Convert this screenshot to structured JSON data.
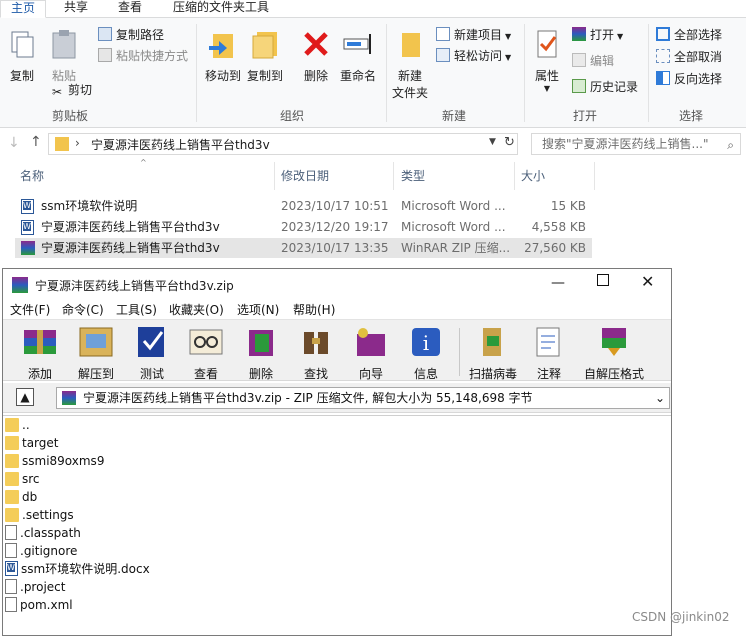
{
  "explorer": {
    "tabs": [
      "主页",
      "共享",
      "查看",
      "压缩的文件夹工具"
    ],
    "ribbon": {
      "clipboard": {
        "copy": "复制",
        "paste": "粘贴",
        "copy_path": "复制路径",
        "paste_shortcut": "粘贴快捷方式",
        "cut": "剪切",
        "group": "剪贴板"
      },
      "organize": {
        "move_to": "移动到",
        "copy_to": "复制到",
        "delete": "删除",
        "rename": "重命名",
        "group": "组织"
      },
      "new": {
        "new_folder_1": "新建",
        "new_folder_2": "文件夹",
        "new_item": "新建项目",
        "easy_access": "轻松访问",
        "group": "新建"
      },
      "open": {
        "properties": "属性",
        "open": "打开",
        "edit": "编辑",
        "history": "历史记录",
        "group": "打开"
      },
      "select": {
        "select_all": "全部选择",
        "select_none": "全部取消",
        "invert": "反向选择",
        "group": "选择"
      }
    },
    "address": {
      "path": "宁夏源沣医药线上销售平台thd3v",
      "search_placeholder": "搜索\"宁夏源沣医药线上销售...\""
    },
    "columns": {
      "name": "名称",
      "date": "修改日期",
      "type": "类型",
      "size": "大小"
    },
    "files": [
      {
        "name": "ssm环境软件说明",
        "date": "2023/10/17 10:51",
        "type": "Microsoft Word ...",
        "size": "15 KB"
      },
      {
        "name": "宁夏源沣医药线上销售平台thd3v",
        "date": "2023/12/20 19:17",
        "type": "Microsoft Word ...",
        "size": "4,558 KB"
      },
      {
        "name": "宁夏源沣医药线上销售平台thd3v",
        "date": "2023/10/17 13:35",
        "type": "WinRAR ZIP 压缩...",
        "size": "27,560 KB"
      }
    ]
  },
  "rar": {
    "title": "宁夏源沣医药线上销售平台thd3v.zip",
    "menu": [
      "文件(F)",
      "命令(C)",
      "工具(S)",
      "收藏夹(O)",
      "选项(N)",
      "帮助(H)"
    ],
    "toolbar": [
      "添加",
      "解压到",
      "测试",
      "查看",
      "删除",
      "查找",
      "向导",
      "信息",
      "扫描病毒",
      "注释",
      "自解压格式"
    ],
    "path_text": "宁夏源沣医药线上销售平台thd3v.zip - ZIP 压缩文件, 解包大小为 55,148,698 字节",
    "items": [
      {
        "name": "..",
        "kind": "folder"
      },
      {
        "name": "target",
        "kind": "folder"
      },
      {
        "name": "ssmi89oxms9",
        "kind": "folder"
      },
      {
        "name": "src",
        "kind": "folder"
      },
      {
        "name": "db",
        "kind": "folder"
      },
      {
        "name": ".settings",
        "kind": "folder"
      },
      {
        "name": ".classpath",
        "kind": "file"
      },
      {
        "name": ".gitignore",
        "kind": "file"
      },
      {
        "name": "ssm环境软件说明.docx",
        "kind": "word"
      },
      {
        "name": ".project",
        "kind": "file"
      },
      {
        "name": "pom.xml",
        "kind": "file"
      }
    ]
  },
  "watermark": "CSDN @jinkin02"
}
